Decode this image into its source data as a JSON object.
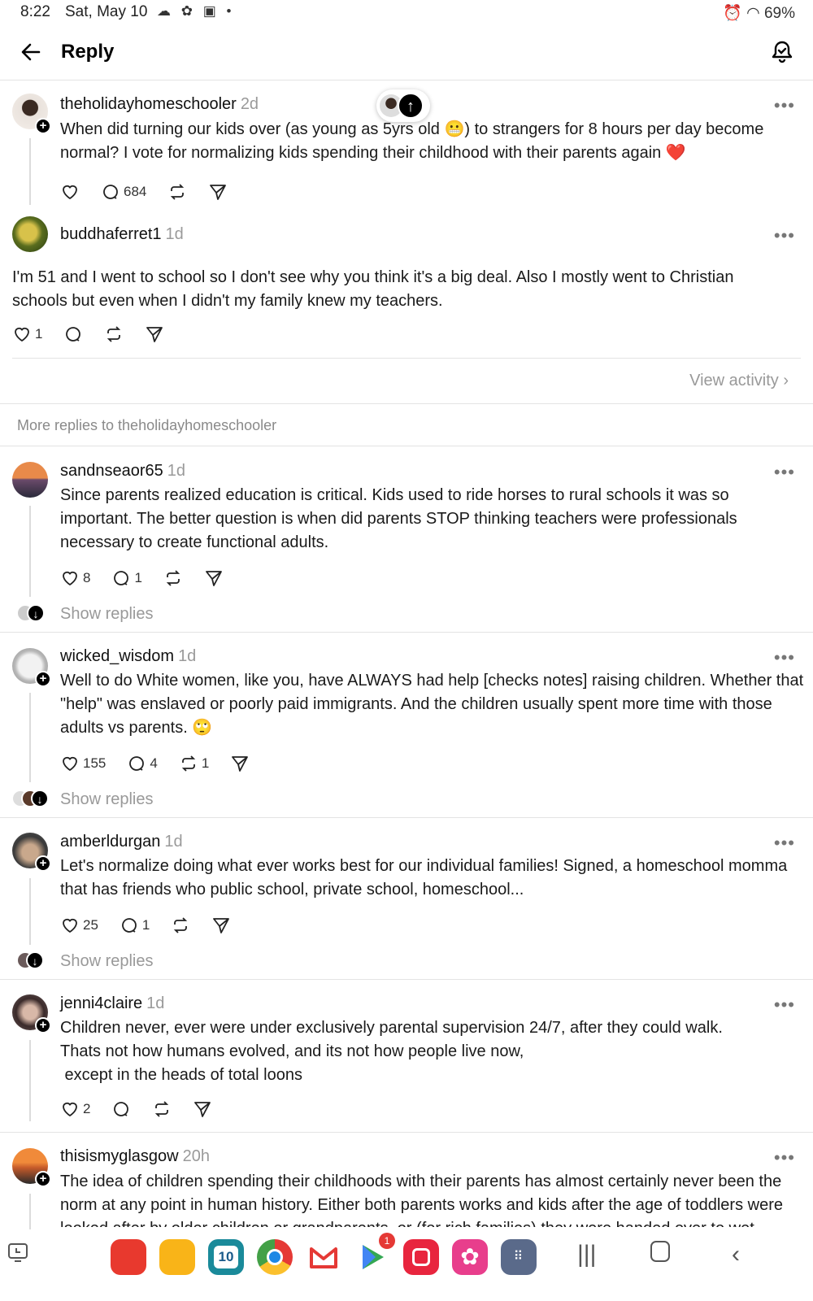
{
  "status": {
    "time": "8:22",
    "date": "Sat, May 10",
    "left_icons": "☁ ✿ ▣ •",
    "right": "⏰ ◠ 69%"
  },
  "header": {
    "title": "Reply"
  },
  "thread": {
    "op": {
      "username": "theholidayhomeschooler",
      "ago": "2d",
      "line1": "When did turning our kids over (as young as 5yrs old 😬) to strangers for 8 hours per day become",
      "line2": "normal? I vote for normalizing kids spending their childhood with their parents again ❤️",
      "replies": "684"
    },
    "reply": {
      "username": "buddhaferret1",
      "ago": "1d",
      "line1": "I'm 51 and I went to school so I don't see why you think it's a big deal. Also I mostly went to Christian",
      "line2": "schools but even when I didn't my family knew my teachers.",
      "likes": "1"
    }
  },
  "view_activity": "View activity ›",
  "more_replies": "More replies to theholidayhomeschooler",
  "posts": [
    {
      "username": "sandnseaor65",
      "ago": "1d",
      "lines": [
        "Since parents realized education is critical.  Kids used to ride horses to rural schools it was so",
        "important. The better question is when did parents STOP thinking teachers were professionals",
        "necessary to create functional adults."
      ],
      "likes": "8",
      "replies": "1",
      "reposts": "",
      "show_replies": "Show replies"
    },
    {
      "username": "wicked_wisdom",
      "ago": "1d",
      "lines": [
        "Well to do White women, like you, have ALWAYS had help [checks notes] raising children. Whether that",
        "\"help\" was enslaved or poorly paid immigrants. And the children usually spent more time with those",
        "adults vs parents. 🙄"
      ],
      "likes": "155",
      "replies": "4",
      "reposts": "1",
      "show_replies": "Show replies"
    },
    {
      "username": "amberldurgan",
      "ago": "1d",
      "lines": [
        "Let's normalize doing what ever works best for our individual families! Signed, a homeschool momma",
        "that has friends who public school, private school, homeschool..."
      ],
      "likes": "25",
      "replies": "1",
      "reposts": "",
      "show_replies": "Show replies"
    },
    {
      "username": "jenni4claire",
      "ago": "1d",
      "lines": [
        "Children never, ever were under exclusively parental supervision 24/7,  after they could walk.",
        "Thats not how humans evolved,  and its not how people live now,",
        " except in the heads of total loons"
      ],
      "likes": "2",
      "replies": "",
      "reposts": "",
      "show_replies": ""
    },
    {
      "username": "thisismyglasgow",
      "ago": "20h",
      "lines": [
        "The idea of children spending their childhoods with their parents has almost certainly never been the",
        "norm at any point in human history. Either both parents works and kids after the age of toddlers were",
        "looked after by older children or grandparents, or (for rich families) they were handed over to wet"
      ],
      "likes": "",
      "replies": "",
      "reposts": "",
      "show_replies": ""
    }
  ],
  "dock": {
    "calendar_day": "10",
    "play_badge": "1"
  },
  "colors": {
    "accent": "#000000",
    "muted": "#999999",
    "divider": "#e3e3e3"
  }
}
